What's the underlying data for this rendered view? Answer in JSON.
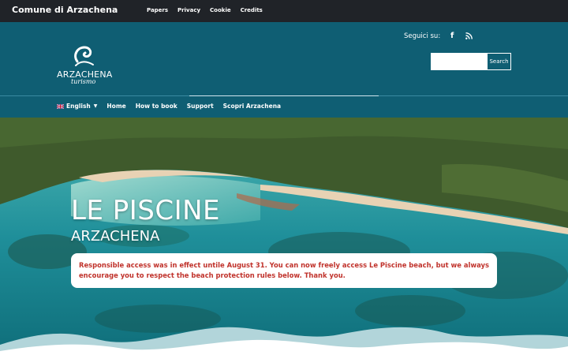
{
  "topbar": {
    "brand": "Comune di Arzachena",
    "links": [
      "Papers",
      "Privacy",
      "Cookie",
      "Credits"
    ]
  },
  "header": {
    "follow_label": "Seguici su:",
    "social_icons": [
      "facebook-icon",
      "rss-icon"
    ],
    "search": {
      "value": "",
      "button_label": "Search"
    },
    "logo": {
      "wordmark": "ARZACHENA",
      "script": "turismo"
    }
  },
  "nav": {
    "language": "English",
    "items": [
      "Home",
      "How to book",
      "Support",
      "Scopri Arzachena"
    ]
  },
  "hero": {
    "title": "LE PISCINE",
    "subtitle": "ARZACHENA",
    "notice": "Responsible access was in effect untile August 31. You can now freely access Le Piscine beach, but we always encourage you to respect the beach protection rules below. Thank you."
  },
  "colors": {
    "topbar": "#202328",
    "header": "#0f5e73",
    "notice_text": "#c0322b",
    "sea": "#1f8f9a",
    "forest": "#3f5a2c",
    "sand": "#e8d2b4"
  }
}
